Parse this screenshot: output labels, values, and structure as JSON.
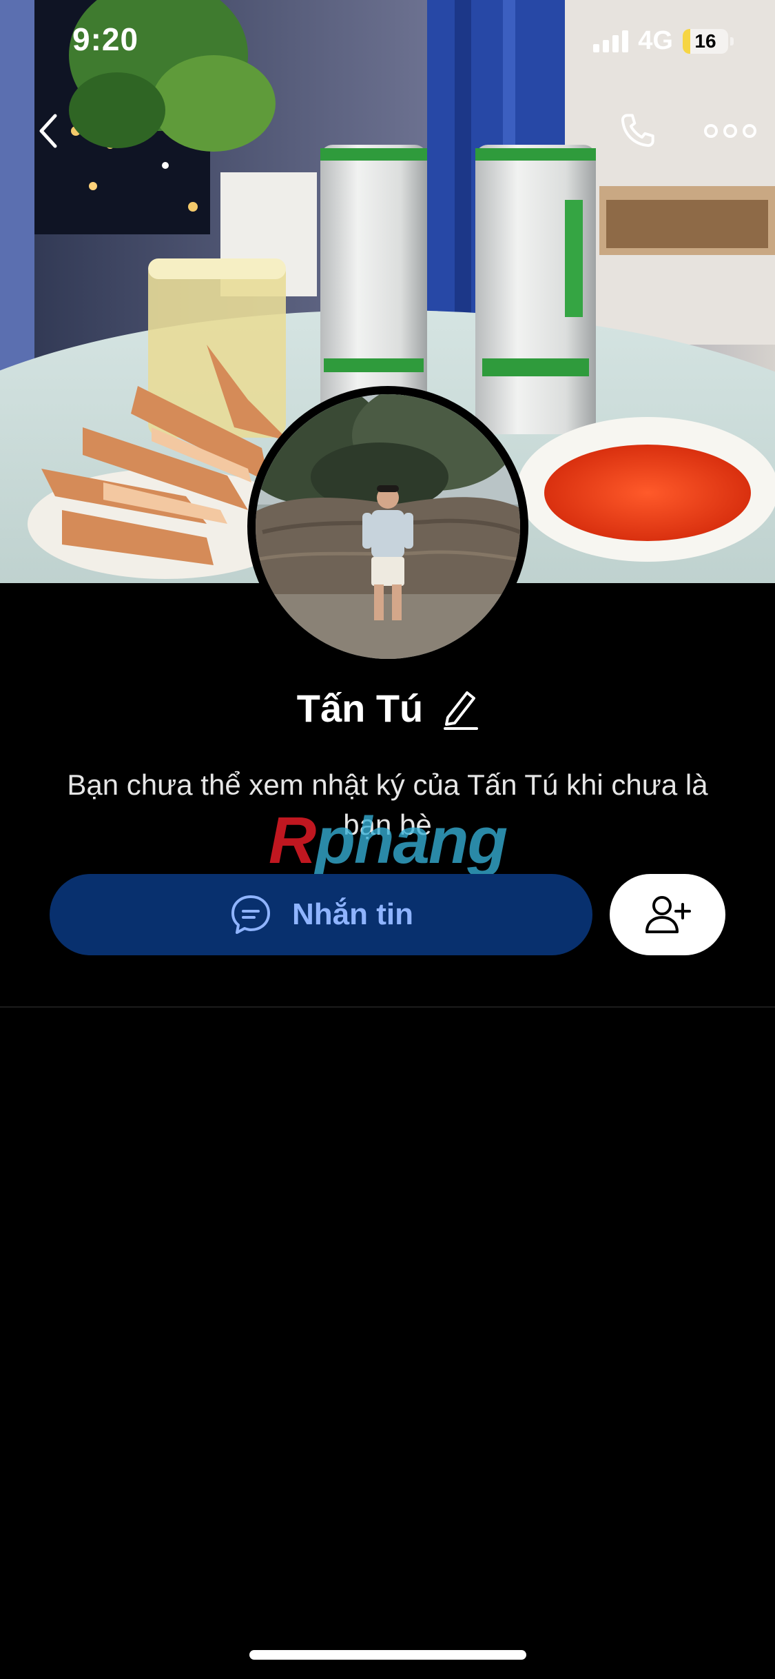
{
  "status_bar": {
    "time": "9:20",
    "network": "4G",
    "battery_level": "16",
    "battery_fraction": 0.16
  },
  "header": {
    "back_icon": "chevron-left-icon",
    "call_icon": "phone-icon",
    "more_icon": "more-horizontal-icon"
  },
  "profile": {
    "name": "Tấn Tú",
    "edit_icon": "pencil-icon",
    "info_text": "Bạn chưa thể xem nhật ký của Tấn Tú khi chưa là bạn bè"
  },
  "watermark": {
    "first_letter": "R",
    "rest": "phang"
  },
  "actions": {
    "message_label": "Nhắn tin",
    "message_icon": "chat-bubble-icon",
    "add_friend_icon": "add-user-icon"
  },
  "colors": {
    "background": "#000000",
    "message_button": "#08306e",
    "message_label": "#8fb4ff",
    "add_friend_button": "#ffffff",
    "battery_fill": "#f6d544"
  }
}
